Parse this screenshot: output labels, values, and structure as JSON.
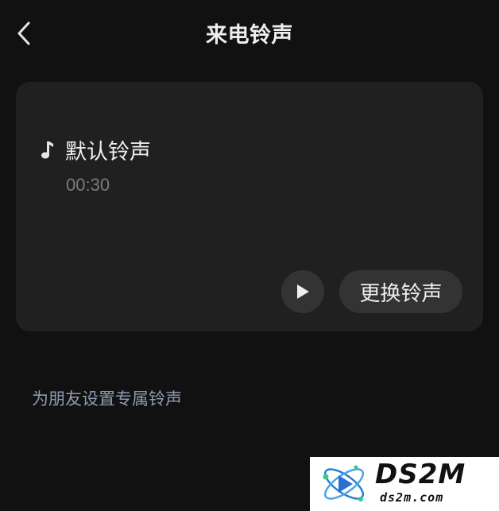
{
  "header": {
    "back_icon": "chevron-left-icon",
    "title": "来电铃声"
  },
  "ringtone_card": {
    "note_icon": "music-note-icon",
    "name": "默认铃声",
    "duration": "00:30",
    "play_icon": "play-icon",
    "change_label": "更换铃声"
  },
  "friend_link": {
    "label": "为朋友设置专属铃声"
  },
  "watermark": {
    "title": "DS2M",
    "url": "ds2m.com"
  },
  "colors": {
    "background": "#111111",
    "card": "#202020",
    "button": "#333333",
    "link": "#8f9bb4",
    "muted": "#7a7a7a"
  }
}
